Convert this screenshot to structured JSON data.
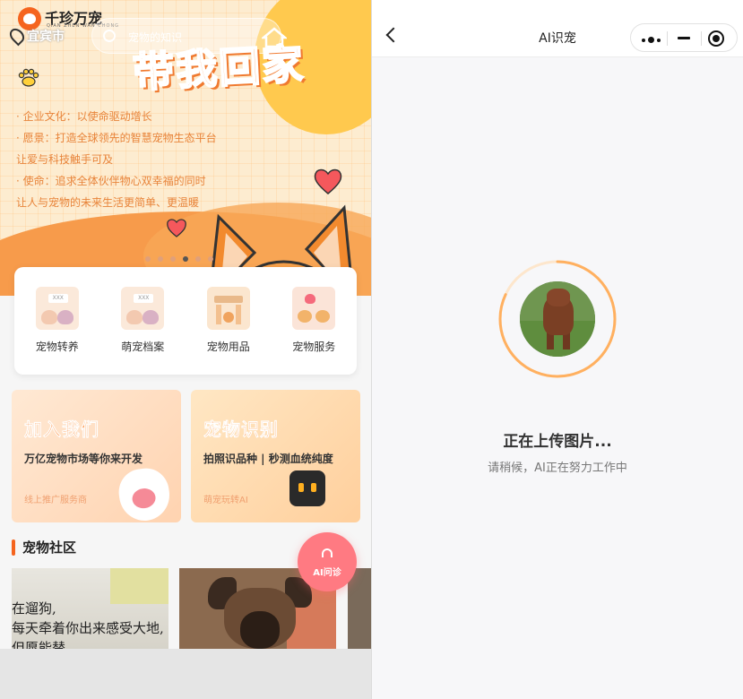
{
  "left": {
    "logo": {
      "text": "千珍万宠",
      "sub": "QIAN ZHEN WAN CHONG"
    },
    "location": {
      "city": "宜宾市"
    },
    "search": {
      "placeholder": "宠物的知识"
    },
    "banner": {
      "headline": "带我回家",
      "mission_lines": [
        "· 企业文化：以使命驱动增长",
        "· 愿景：打造全球领先的智慧宠物生态平台",
        "让爱与科技触手可及",
        "· 使命：追求全体伙伴物心双幸福的同时",
        "让人与宠物的未来生活更简单、更温暖"
      ],
      "carousel_active_index": 3,
      "carousel_count": 6
    },
    "quick_actions": [
      {
        "label": "宠物转养",
        "icon": "cats-adoption-icon",
        "tag": "XXX"
      },
      {
        "label": "萌宠档案",
        "icon": "cats-profile-icon",
        "tag": "XXX"
      },
      {
        "label": "宠物用品",
        "icon": "pet-supplies-icon"
      },
      {
        "label": "宠物服务",
        "icon": "pet-services-icon"
      }
    ],
    "promo_cards": [
      {
        "title": "加入我们",
        "subtitle": "万亿宠物市场等你来开发",
        "small": "线上推广服务商"
      },
      {
        "title": "宠物识别",
        "subtitle": "拍照识品种 | 秒测血统纯度",
        "small": "萌宠玩转AI"
      }
    ],
    "community": {
      "title": "宠物社区",
      "post1_text_lines": [
        "在遛狗,",
        "每天牵着你出来感受大地,",
        "但愿能替"
      ]
    },
    "fab": {
      "label": "AI问诊"
    }
  },
  "right": {
    "nav": {
      "title": "AI识宠"
    },
    "status": {
      "title": "正在上传图片...",
      "subtitle": "请稍候，AI正在努力工作中"
    },
    "progress_arc_fraction": 0.82
  },
  "colors": {
    "accent_orange": "#f5641e",
    "banner_bg": "#fdecd0",
    "fab_pink": "#ff7a82",
    "ring_orange": "#ffb060"
  }
}
